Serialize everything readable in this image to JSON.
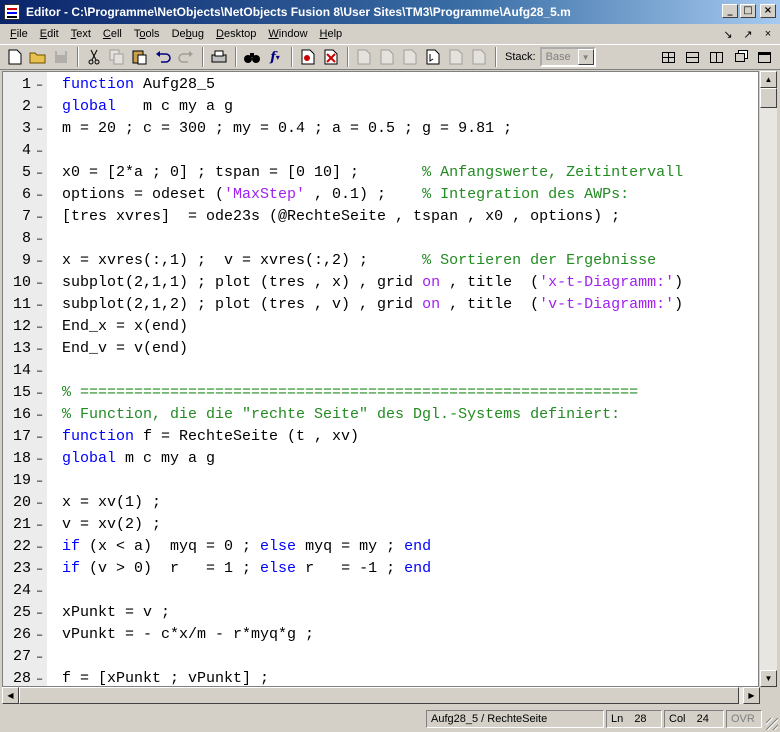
{
  "window": {
    "title": "Editor - C:\\Programme\\NetObjects\\NetObjects Fusion 8\\User Sites\\TM3\\Programme\\Aufg28_5.m",
    "minimize": "_",
    "maximize": "□",
    "close": "×"
  },
  "menu": {
    "items": [
      {
        "pre": "",
        "u": "F",
        "post": "ile"
      },
      {
        "pre": "",
        "u": "E",
        "post": "dit"
      },
      {
        "pre": "",
        "u": "T",
        "post": "ext"
      },
      {
        "pre": "",
        "u": "C",
        "post": "ell"
      },
      {
        "pre": "T",
        "u": "o",
        "post": "ols"
      },
      {
        "pre": "De",
        "u": "b",
        "post": "ug"
      },
      {
        "pre": "",
        "u": "D",
        "post": "esktop"
      },
      {
        "pre": "",
        "u": "W",
        "post": "indow"
      },
      {
        "pre": "",
        "u": "H",
        "post": "elp"
      }
    ],
    "right_icons": [
      "↘",
      "↗",
      "×"
    ]
  },
  "toolbar": {
    "stack_label": "Stack:",
    "stack_value": "Base"
  },
  "code": {
    "lines": [
      {
        "n": "1",
        "parts": [
          {
            "t": "function",
            "c": "kw"
          },
          {
            "t": " Aufg28_5",
            "c": ""
          }
        ]
      },
      {
        "n": "2",
        "parts": [
          {
            "t": "global",
            "c": "kw"
          },
          {
            "t": "   m c my a g",
            "c": ""
          }
        ]
      },
      {
        "n": "3",
        "parts": [
          {
            "t": "m = 20 ; c = 300 ; my = 0.4 ; a = 0.5 ; g = 9.81 ;",
            "c": ""
          }
        ]
      },
      {
        "n": "4",
        "parts": []
      },
      {
        "n": "5",
        "parts": [
          {
            "t": "x0 = [2*a ; 0] ; tspan = [0 10] ;       ",
            "c": ""
          },
          {
            "t": "% Anfangswerte, Zeitintervall",
            "c": "cm"
          }
        ]
      },
      {
        "n": "6",
        "parts": [
          {
            "t": "options = odeset (",
            "c": ""
          },
          {
            "t": "'MaxStep'",
            "c": "str"
          },
          {
            "t": " , 0.1) ;    ",
            "c": ""
          },
          {
            "t": "% Integration des AWPs:",
            "c": "cm"
          }
        ]
      },
      {
        "n": "7",
        "parts": [
          {
            "t": "[tres xvres]  = ode23s (@RechteSeite , tspan , x0 , options) ;",
            "c": ""
          }
        ]
      },
      {
        "n": "8",
        "parts": []
      },
      {
        "n": "9",
        "parts": [
          {
            "t": "x = xvres(:,1) ;  v = xvres(:,2) ;      ",
            "c": ""
          },
          {
            "t": "% Sortieren der Ergebnisse",
            "c": "cm"
          }
        ]
      },
      {
        "n": "10",
        "parts": [
          {
            "t": "subplot(2,1,1) ; plot (tres , x) , grid ",
            "c": ""
          },
          {
            "t": "on",
            "c": "str"
          },
          {
            "t": " , title  (",
            "c": ""
          },
          {
            "t": "'x-t-Diagramm:'",
            "c": "str"
          },
          {
            "t": ")",
            "c": ""
          }
        ]
      },
      {
        "n": "11",
        "parts": [
          {
            "t": "subplot(2,1,2) ; plot (tres , v) , grid ",
            "c": ""
          },
          {
            "t": "on",
            "c": "str"
          },
          {
            "t": " , title  (",
            "c": ""
          },
          {
            "t": "'v-t-Diagramm:'",
            "c": "str"
          },
          {
            "t": ")",
            "c": ""
          }
        ]
      },
      {
        "n": "12",
        "parts": [
          {
            "t": "End_x = x(end)",
            "c": ""
          }
        ]
      },
      {
        "n": "13",
        "parts": [
          {
            "t": "End_v = v(end)",
            "c": ""
          }
        ]
      },
      {
        "n": "14",
        "parts": []
      },
      {
        "n": "15",
        "parts": [
          {
            "t": "% ==============================================================",
            "c": "cm"
          }
        ]
      },
      {
        "n": "16",
        "parts": [
          {
            "t": "% Function, die die \"rechte Seite\" des Dgl.-Systems definiert:",
            "c": "cm"
          }
        ]
      },
      {
        "n": "17",
        "parts": [
          {
            "t": "function",
            "c": "kw"
          },
          {
            "t": " f = RechteSeite (t , xv)",
            "c": ""
          }
        ]
      },
      {
        "n": "18",
        "parts": [
          {
            "t": "global",
            "c": "kw"
          },
          {
            "t": " m c my a g",
            "c": ""
          }
        ]
      },
      {
        "n": "19",
        "parts": []
      },
      {
        "n": "20",
        "parts": [
          {
            "t": "x = xv(1) ;",
            "c": ""
          }
        ]
      },
      {
        "n": "21",
        "parts": [
          {
            "t": "v = xv(2) ;",
            "c": ""
          }
        ]
      },
      {
        "n": "22",
        "parts": [
          {
            "t": "if",
            "c": "kw"
          },
          {
            "t": " (x < a)  myq = 0 ; ",
            "c": ""
          },
          {
            "t": "else",
            "c": "kw"
          },
          {
            "t": " myq = my ; ",
            "c": ""
          },
          {
            "t": "end",
            "c": "kw"
          }
        ]
      },
      {
        "n": "23",
        "parts": [
          {
            "t": "if",
            "c": "kw"
          },
          {
            "t": " (v > 0)  r   = 1 ; ",
            "c": ""
          },
          {
            "t": "else",
            "c": "kw"
          },
          {
            "t": " r   = -1 ; ",
            "c": ""
          },
          {
            "t": "end",
            "c": "kw"
          }
        ]
      },
      {
        "n": "24",
        "parts": []
      },
      {
        "n": "25",
        "parts": [
          {
            "t": "xPunkt = v ;",
            "c": ""
          }
        ]
      },
      {
        "n": "26",
        "parts": [
          {
            "t": "vPunkt = - c*x/m - r*myq*g ;",
            "c": ""
          }
        ]
      },
      {
        "n": "27",
        "parts": []
      },
      {
        "n": "28",
        "parts": [
          {
            "t": "f = [xPunkt ; vPunkt] ;",
            "c": ""
          }
        ]
      }
    ]
  },
  "status": {
    "function": "Aufg28_5 / RechteSeite",
    "ln_label": "Ln",
    "ln_value": "28",
    "col_label": "Col",
    "col_value": "24",
    "ovr": "OVR"
  }
}
